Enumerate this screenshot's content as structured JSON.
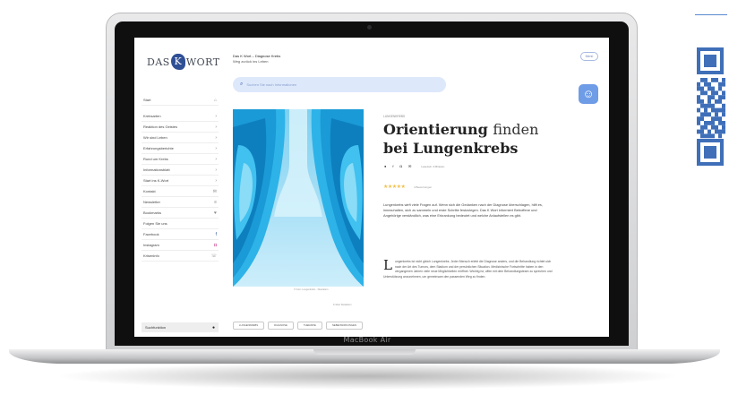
{
  "device": {
    "model_label": "MacBook Air"
  },
  "site": {
    "logo_left": "DAS",
    "logo_k": "K",
    "logo_right": "WORT",
    "header_title": "Das K Wort – Diagnose Krebs",
    "header_subtitle": "Weg zurück ins Leben",
    "menu_label": "Menü",
    "search_placeholder": "Suchen Sie nach Informationen"
  },
  "sidebar": {
    "items": [
      {
        "label": "Start",
        "icon": "home-icon",
        "glyph": "⌂"
      },
      {
        "label": "Krebsarten",
        "icon": "chevron-right-icon",
        "glyph": "›"
      },
      {
        "label": "Reaktion des Geistes",
        "icon": "chevron-right-icon",
        "glyph": "›"
      },
      {
        "label": "Wir sind Leben",
        "icon": "chevron-right-icon",
        "glyph": "›"
      },
      {
        "label": "Erfahrungsberichte",
        "icon": "chevron-right-icon",
        "glyph": "›"
      },
      {
        "label": "Rund um Krebs",
        "icon": "chevron-right-icon",
        "glyph": "›"
      },
      {
        "label": "Informationsblatt",
        "icon": "chevron-right-icon",
        "glyph": "›"
      },
      {
        "label": "Start ins K-Wort",
        "icon": "chevron-right-icon",
        "glyph": "›"
      },
      {
        "label": "Kontakt",
        "icon": "mail-icon",
        "glyph": "✉"
      },
      {
        "label": "Newsletter",
        "icon": "newsletter-icon",
        "glyph": "≡"
      },
      {
        "label": "Bookmarks",
        "icon": "bookmark-icon",
        "glyph": "♥"
      }
    ],
    "social_heading": "Folgen Sie uns",
    "social": [
      {
        "label": "Facebook",
        "icon": "facebook-icon",
        "glyph": "f",
        "cls": "fb"
      },
      {
        "label": "Instagram",
        "icon": "instagram-icon",
        "glyph": "◘",
        "cls": "ig"
      },
      {
        "label": "Kriseninfo",
        "icon": "phone-icon",
        "glyph": "☏",
        "cls": "yt"
      }
    ],
    "bottom_label": "Suchfunktion",
    "bottom_icon": "●"
  },
  "article": {
    "kicker": "LUNGENKREBS",
    "title_part1": "Orientierung",
    "title_part2": "finden",
    "title_part3": "bei Lungenkrebs",
    "share_icons": [
      "●",
      "f",
      "◘",
      "✉"
    ],
    "share_meta": "Lesezeit: 4 Minuten",
    "rating_stars": "★★★★★",
    "rating_label": "4 Bewertungen",
    "intro": "Lungenkrebs wirft viele Fragen auf. Wenn sich die Gedanken nach der Diagnose überschlagen, hilft es, innezuhalten, sich zu sammeln und erste Schritte festzulegen. Das K Wort informiert Betroffene und Angehörige verständlich, was eine Erkrankung bedeutet und welche Anlaufstellen es gibt.",
    "body_dropcap": "L",
    "body": "ungenkrebs ist nicht gleich Lungenkrebs. Jeder Mensch erlebt die Diagnose anders, und die Behandlung richtet sich nach der Art des Tumors, dem Stadium und der persönlichen Situation. Medizinische Fortschritte haben in den vergangenen Jahren viele neue Möglichkeiten eröffnet. Wichtig ist, offen mit dem Behandlungsteam zu sprechen und Unterstützung anzunehmen, um gemeinsam den passenden Weg zu finden.",
    "image_caption": "© Foto: Lungenkrebs · Illustration",
    "image_credit": "K-Wort Redaktion",
    "tags": [
      "LUNGENKREBS",
      "DIAGNOSE",
      "THERAPIE",
      "NEBENWIRKUNGEN"
    ]
  },
  "colors": {
    "accent": "#2f4f95",
    "search_bg": "#dde8fb",
    "accessibility_bg": "#6f9ce6",
    "qr": "#3f6fb8",
    "star": "#f2c14e"
  }
}
